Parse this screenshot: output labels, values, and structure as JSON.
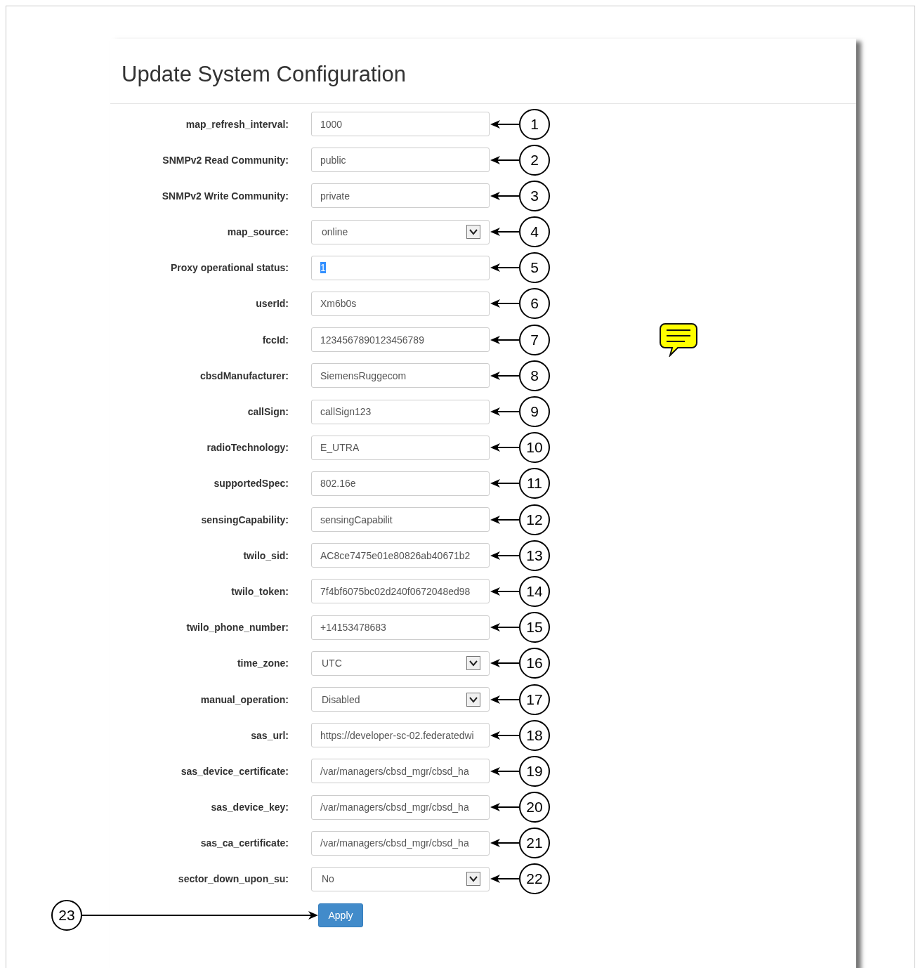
{
  "title": "Update System Configuration",
  "fields": [
    {
      "label": "map_refresh_interval:",
      "kind": "text",
      "value": "1000",
      "highlighted": false,
      "callout": "1"
    },
    {
      "label": "SNMPv2 Read Community:",
      "kind": "text",
      "value": "public",
      "highlighted": false,
      "callout": "2"
    },
    {
      "label": "SNMPv2 Write Community:",
      "kind": "text",
      "value": "private",
      "highlighted": false,
      "callout": "3"
    },
    {
      "label": "map_source:",
      "kind": "select",
      "value": "online",
      "highlighted": false,
      "callout": "4"
    },
    {
      "label": "Proxy operational status:",
      "kind": "text",
      "value": "1",
      "highlighted": true,
      "callout": "5"
    },
    {
      "label": "userId:",
      "kind": "text",
      "value": "Xm6b0s",
      "highlighted": false,
      "callout": "6"
    },
    {
      "label": "fccId:",
      "kind": "text",
      "value": "1234567890123456789",
      "highlighted": false,
      "callout": "7"
    },
    {
      "label": "cbsdManufacturer:",
      "kind": "text",
      "value": "SiemensRuggecom",
      "highlighted": false,
      "callout": "8"
    },
    {
      "label": "callSign:",
      "kind": "text",
      "value": "callSign123",
      "highlighted": false,
      "callout": "9"
    },
    {
      "label": "radioTechnology:",
      "kind": "text",
      "value": "E_UTRA",
      "highlighted": false,
      "callout": "10"
    },
    {
      "label": "supportedSpec:",
      "kind": "text",
      "value": "802.16e",
      "highlighted": false,
      "callout": "11"
    },
    {
      "label": "sensingCapability:",
      "kind": "text",
      "value": "sensingCapabilit",
      "highlighted": false,
      "callout": "12"
    },
    {
      "label": "twilo_sid:",
      "kind": "text",
      "value": "AC8ce7475e01e80826ab40671b2",
      "highlighted": false,
      "callout": "13"
    },
    {
      "label": "twilo_token:",
      "kind": "text",
      "value": "7f4bf6075bc02d240f0672048ed98",
      "highlighted": false,
      "callout": "14"
    },
    {
      "label": "twilo_phone_number:",
      "kind": "text",
      "value": "+14153478683",
      "highlighted": false,
      "callout": "15"
    },
    {
      "label": "time_zone:",
      "kind": "select",
      "value": "UTC",
      "highlighted": false,
      "callout": "16"
    },
    {
      "label": "manual_operation:",
      "kind": "select",
      "value": "Disabled",
      "highlighted": false,
      "callout": "17"
    },
    {
      "label": "sas_url:",
      "kind": "text",
      "value": "https://developer-sc-02.federatedwi",
      "highlighted": false,
      "callout": "18"
    },
    {
      "label": "sas_device_certificate:",
      "kind": "text",
      "value": "/var/managers/cbsd_mgr/cbsd_ha",
      "highlighted": false,
      "callout": "19"
    },
    {
      "label": "sas_device_key:",
      "kind": "text",
      "value": "/var/managers/cbsd_mgr/cbsd_ha",
      "highlighted": false,
      "callout": "20"
    },
    {
      "label": "sas_ca_certificate:",
      "kind": "text",
      "value": "/var/managers/cbsd_mgr/cbsd_ha",
      "highlighted": false,
      "callout": "21"
    },
    {
      "label": "sector_down_upon_su:",
      "kind": "select",
      "value": "No",
      "highlighted": false,
      "callout": "22"
    }
  ],
  "apply": {
    "label": "Apply",
    "callout": "23"
  }
}
